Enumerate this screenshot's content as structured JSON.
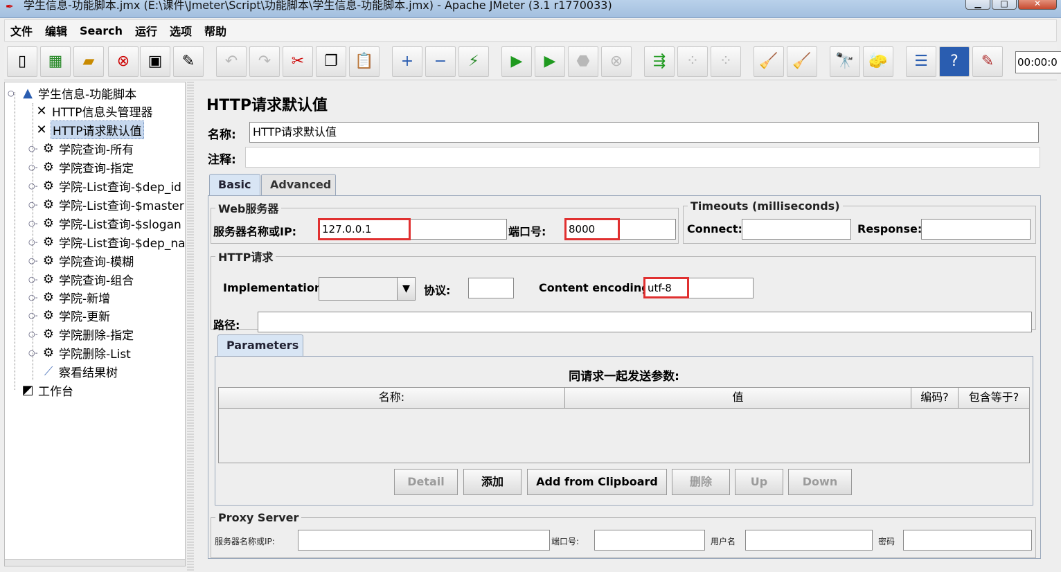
{
  "window": {
    "title": "学生信息-功能脚本.jmx (E:\\课件\\Jmeter\\Script\\功能脚本\\学生信息-功能脚本.jmx) - Apache JMeter (3.1 r1770033)"
  },
  "menu": [
    "文件",
    "编辑",
    "Search",
    "运行",
    "选项",
    "帮助"
  ],
  "toolbar": {
    "timer": "00:00:0"
  },
  "tree": {
    "root": "学生信息-功能脚本",
    "items": [
      "HTTP信息头管理器",
      "HTTP请求默认值",
      "学院查询-所有",
      "学院查询-指定",
      "学院-List查询-$dep_id",
      "学院-List查询-$master",
      "学院-List查询-$slogan",
      "学院-List查询-$dep_na",
      "学院查询-模糊",
      "学院查询-组合",
      "学院-新增",
      "学院-更新",
      "学院删除-指定",
      "学院删除-List",
      "察看结果树"
    ],
    "workbench": "工作台"
  },
  "main": {
    "title": "HTTP请求默认值",
    "name_label": "名称:",
    "name_value": "HTTP请求默认值",
    "comment_label": "注释:",
    "tabs": [
      "Basic",
      "Advanced"
    ],
    "web_server": {
      "legend": "Web服务器",
      "server_label": "服务器名称或IP:",
      "server_value": "127.0.0.1",
      "port_label": "端口号:",
      "port_value": "8000"
    },
    "timeouts": {
      "legend": "Timeouts (milliseconds)",
      "connect_label": "Connect:",
      "response_label": "Response:"
    },
    "http_request": {
      "legend": "HTTP请求",
      "implementation_label": "Implementation:",
      "protocol_label": "协议:",
      "encoding_label": "Content encoding:",
      "encoding_value": "utf-8",
      "path_label": "路径:"
    },
    "parameters": {
      "tab": "Parameters",
      "heading": "同请求一起发送参数:",
      "columns": [
        "名称:",
        "值",
        "编码?",
        "包含等于?"
      ],
      "buttons": [
        "Detail",
        "添加",
        "Add from Clipboard",
        "删除",
        "Up",
        "Down"
      ]
    },
    "proxy": {
      "legend": "Proxy Server",
      "server_label": "服务器名称或IP:",
      "port_label": "端口号:",
      "user_label": "用户名",
      "password_label": "密码"
    }
  }
}
